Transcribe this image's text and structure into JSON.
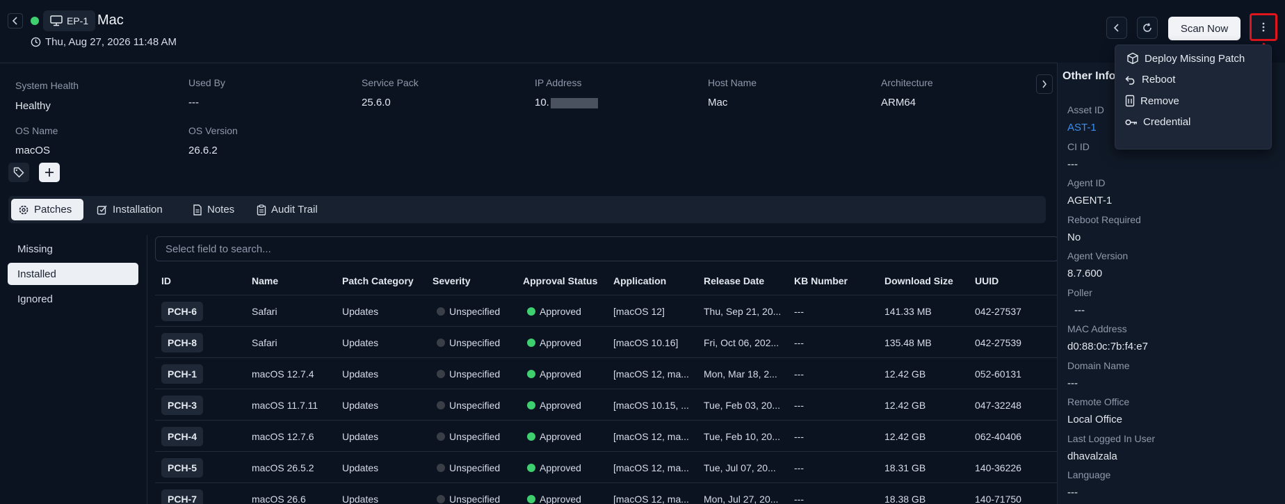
{
  "header": {
    "endpoint_id": "EP-1",
    "host_name": "Mac",
    "datetime": "Thu, Aug 27, 2026 11:48 AM",
    "scan_label": "Scan Now"
  },
  "menu": {
    "items": [
      {
        "label": "Deploy Missing Patch",
        "icon": "package-icon"
      },
      {
        "label": "Reboot",
        "icon": "undo-arrow-icon"
      },
      {
        "label": "Remove",
        "icon": "trash-icon"
      },
      {
        "label": "Credential",
        "icon": "key-icon"
      }
    ]
  },
  "info": {
    "system_health_label": "System Health",
    "system_health": "Healthy",
    "used_by_label": "Used By",
    "used_by": "---",
    "service_pack_label": "Service Pack",
    "service_pack": "25.6.0",
    "ip_label": "IP Address",
    "ip_prefix": "10.",
    "host_name_label": "Host Name",
    "host_name": "Mac",
    "architecture_label": "Architecture",
    "architecture": "ARM64",
    "os_name_label": "OS Name",
    "os_name": "macOS",
    "os_version_label": "OS Version",
    "os_version": "26.6.2"
  },
  "tabs": [
    {
      "label": "Patches",
      "icon": "gear-icon"
    },
    {
      "label": "Installation",
      "icon": "install-icon"
    },
    {
      "label": "Notes",
      "icon": "document-icon"
    },
    {
      "label": "Audit Trail",
      "icon": "clipboard-icon"
    }
  ],
  "subnav": [
    "Missing",
    "Installed",
    "Ignored"
  ],
  "search": {
    "placeholder": "Select field to search..."
  },
  "table": {
    "columns": [
      "ID",
      "Name",
      "Patch Category",
      "Severity",
      "Approval Status",
      "Application",
      "Release Date",
      "KB Number",
      "Download Size",
      "UUID"
    ],
    "rows": [
      {
        "id": "PCH-6",
        "name": "Safari",
        "category": "Updates",
        "severity": "Unspecified",
        "approval": "Approved",
        "application": "[macOS 12]",
        "release": "Thu, Sep 21, 20...",
        "kb": "---",
        "size": "141.33 MB",
        "uuid": "042-27537"
      },
      {
        "id": "PCH-8",
        "name": "Safari",
        "category": "Updates",
        "severity": "Unspecified",
        "approval": "Approved",
        "application": "[macOS 10.16]",
        "release": "Fri, Oct 06, 202...",
        "kb": "---",
        "size": "135.48 MB",
        "uuid": "042-27539"
      },
      {
        "id": "PCH-1",
        "name": "macOS 12.7.4",
        "category": "Updates",
        "severity": "Unspecified",
        "approval": "Approved",
        "application": "[macOS 12, ma...",
        "release": "Mon, Mar 18, 2...",
        "kb": "---",
        "size": "12.42 GB",
        "uuid": "052-60131"
      },
      {
        "id": "PCH-3",
        "name": "macOS 11.7.11",
        "category": "Updates",
        "severity": "Unspecified",
        "approval": "Approved",
        "application": "[macOS 10.15, ...",
        "release": "Tue, Feb 03, 20...",
        "kb": "---",
        "size": "12.42 GB",
        "uuid": "047-32248"
      },
      {
        "id": "PCH-4",
        "name": "macOS 12.7.6",
        "category": "Updates",
        "severity": "Unspecified",
        "approval": "Approved",
        "application": "[macOS 12, ma...",
        "release": "Tue, Feb 10, 20...",
        "kb": "---",
        "size": "12.42 GB",
        "uuid": "062-40406"
      },
      {
        "id": "PCH-5",
        "name": "macOS 26.5.2",
        "category": "Updates",
        "severity": "Unspecified",
        "approval": "Approved",
        "application": "[macOS 12, ma...",
        "release": "Tue, Jul 07, 20...",
        "kb": "---",
        "size": "18.31 GB",
        "uuid": "140-36226"
      },
      {
        "id": "PCH-7",
        "name": "macOS 26.6",
        "category": "Updates",
        "severity": "Unspecified",
        "approval": "Approved",
        "application": "[macOS 12, ma...",
        "release": "Mon, Jul 27, 20...",
        "kb": "---",
        "size": "18.38 GB",
        "uuid": "140-71750"
      }
    ]
  },
  "right_panel": {
    "title": "Other Info",
    "fields": [
      {
        "label": "Asset ID",
        "value": "AST-1"
      },
      {
        "label": "CI ID",
        "value": "---"
      },
      {
        "label": "Agent ID",
        "value": "AGENT-1"
      },
      {
        "label": "Reboot Required",
        "value": "No"
      },
      {
        "label": "Agent Version",
        "value": "8.7.600"
      },
      {
        "label": "Poller",
        "value": "---"
      },
      {
        "label": "MAC Address",
        "value": "d0:88:0c:7b:f4:e7"
      },
      {
        "label": "Domain Name",
        "value": "---"
      },
      {
        "label": "Remote Office",
        "value": "Local Office"
      },
      {
        "label": "Last Logged In User",
        "value": "dhavalzala"
      },
      {
        "label": "Language",
        "value": "---"
      }
    ]
  },
  "colors": {
    "background": "#0b1321",
    "accent_link": "#3b8ff0",
    "status_green": "#3ecf6e",
    "severity_gray": "#3a3f47",
    "highlight_red": "#e2141c"
  }
}
